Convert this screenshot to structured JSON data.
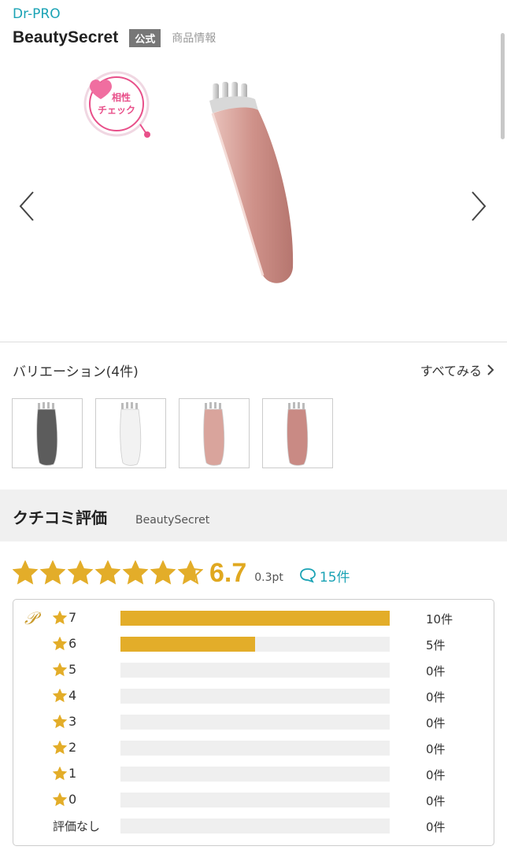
{
  "header": {
    "brand": "Dr-PRO",
    "product_name": "BeautySecret",
    "official_badge": "公式",
    "info_link": "商品情報"
  },
  "gallery": {
    "compat_badge_text_line1": "相性",
    "compat_badge_text_line2": "チェック"
  },
  "variations": {
    "heading": "バリエーション(4件)",
    "see_all": "すべてみる",
    "items": [
      {
        "color": "#5c5c5c"
      },
      {
        "color": "#f2f2f2"
      },
      {
        "color": "#d9a49c"
      },
      {
        "color": "#c98a84"
      }
    ]
  },
  "review": {
    "heading": "クチコミ評価",
    "subheading": "BeautySecret",
    "score": "6.7",
    "point_diff": "0.3pt",
    "review_count": "15件",
    "star_count": 7,
    "rating_value": 6.7,
    "accent_color": "#e3ad29",
    "distribution": [
      {
        "label": "7",
        "count_text": "10件",
        "value": 10
      },
      {
        "label": "6",
        "count_text": "5件",
        "value": 5
      },
      {
        "label": "5",
        "count_text": "0件",
        "value": 0
      },
      {
        "label": "4",
        "count_text": "0件",
        "value": 0
      },
      {
        "label": "3",
        "count_text": "0件",
        "value": 0
      },
      {
        "label": "2",
        "count_text": "0件",
        "value": 0
      },
      {
        "label": "1",
        "count_text": "0件",
        "value": 0
      },
      {
        "label": "0",
        "count_text": "0件",
        "value": 0
      },
      {
        "label": "評価なし",
        "count_text": "0件",
        "value": 0
      }
    ],
    "max_value": 10
  }
}
